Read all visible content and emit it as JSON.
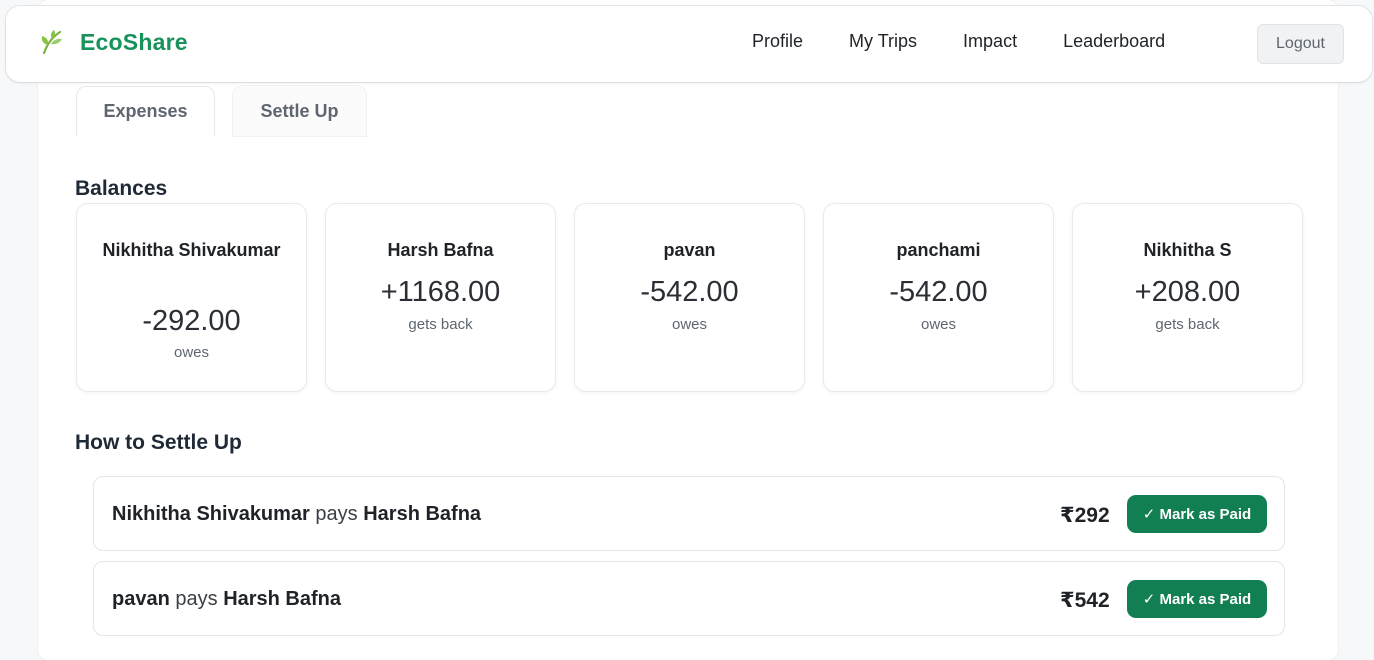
{
  "brand": {
    "name": "EcoShare",
    "icon": "leaf-icon",
    "color": "#17935a"
  },
  "nav": {
    "links": [
      "Profile",
      "My Trips",
      "Impact",
      "Leaderboard"
    ],
    "logout_label": "Logout"
  },
  "tabs": {
    "expenses": "Expenses",
    "settle_up": "Settle Up"
  },
  "balances": {
    "title": "Balances",
    "items": [
      {
        "name": "Nikhitha Shivakumar",
        "amount": "-292.00",
        "status": "owes"
      },
      {
        "name": "Harsh Bafna",
        "amount": "+1168.00",
        "status": "gets back"
      },
      {
        "name": "pavan",
        "amount": "-542.00",
        "status": "owes"
      },
      {
        "name": "panchami",
        "amount": "-542.00",
        "status": "owes"
      },
      {
        "name": "Nikhitha S",
        "amount": "+208.00",
        "status": "gets back"
      }
    ]
  },
  "settle": {
    "title": "How to Settle Up",
    "pays_word": "pays",
    "button_label": "✓ Mark as Paid",
    "button_color": "#127f52",
    "items": [
      {
        "from": "Nikhitha Shivakumar",
        "to": "Harsh Bafna",
        "amount": "₹292"
      },
      {
        "from": "pavan",
        "to": "Harsh Bafna",
        "amount": "₹542"
      }
    ]
  }
}
